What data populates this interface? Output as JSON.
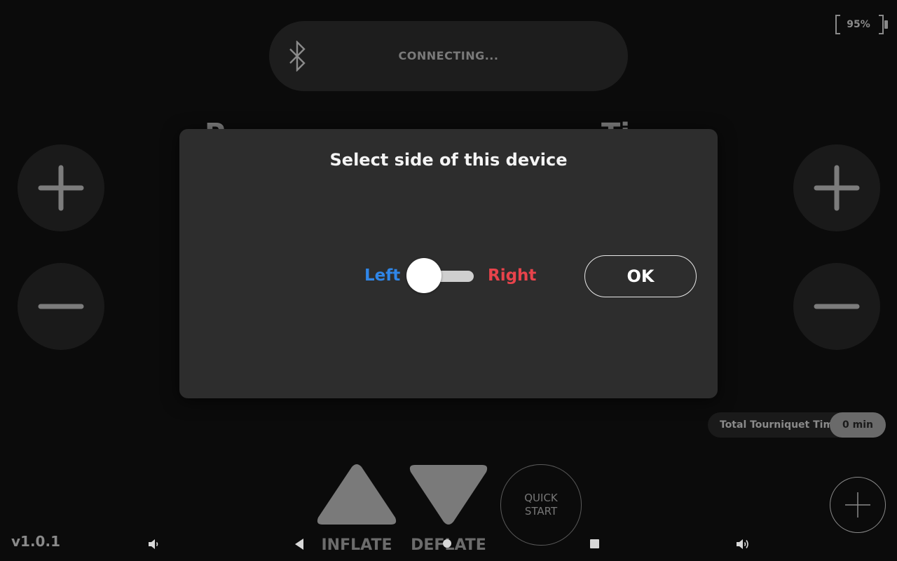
{
  "status": {
    "connection_text": "CONNECTING...",
    "battery_percent": "95%"
  },
  "background_labels": {
    "left_partial": "P",
    "right_partial": "Ti"
  },
  "dialog": {
    "title": "Select side of this device",
    "left_label": "Left",
    "right_label": "Right",
    "ok_label": "OK",
    "selected_side": "Left"
  },
  "tourniquet": {
    "label": "Total Tourniquet Time",
    "value": "0 min"
  },
  "controls": {
    "inflate_label": "INFLATE",
    "deflate_label": "DEFLATE",
    "quick_start_line1": "QUICK",
    "quick_start_line2": "START"
  },
  "version": "v1.0.1",
  "colors": {
    "left": "#2f86e8",
    "right": "#e8434b",
    "background": "#0b0b0b",
    "dialog": "#2d2d2d"
  },
  "icons": {
    "bluetooth": "bluetooth-icon",
    "plus": "plus-icon",
    "minus": "minus-icon",
    "volume_down": "volume-down-icon",
    "volume_up": "volume-up-icon",
    "back": "back-icon",
    "home": "home-icon",
    "recents": "recents-icon"
  }
}
